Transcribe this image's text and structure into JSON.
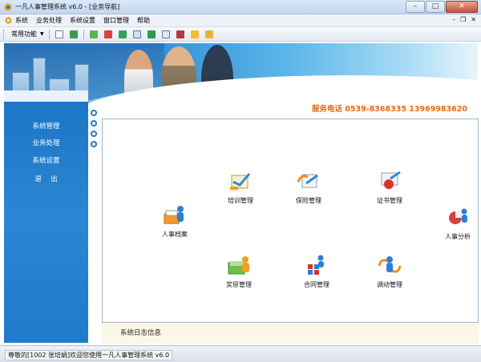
{
  "window": {
    "title": "一凡人事管理系统 v6.0 - [业务导航]",
    "minimize": "–",
    "maximize": "□",
    "close": "✕"
  },
  "menu": {
    "items": [
      "系统",
      "业务处理",
      "系统设置",
      "窗口管理",
      "帮助"
    ],
    "mdi_minimize": "–",
    "mdi_restore": "❐",
    "mdi_close": "✕"
  },
  "toolbar": {
    "dropdown_label": "常用功能"
  },
  "banner": {
    "hotline": "服务电话  0539-8368335  13969983620"
  },
  "nav": {
    "items": [
      "系统管理",
      "业务处理",
      "系统设置",
      "退　 出"
    ]
  },
  "modules": {
    "training": "培训管理",
    "insurance": "保险管理",
    "certificate": "证书管理",
    "personnel_file": "人事档案",
    "personnel_analysis": "人事分析",
    "reward_punish": "奖惩管理",
    "contract": "合同管理",
    "transfer": "调动管理"
  },
  "log": {
    "label": "系统日志信息"
  },
  "status": {
    "text": "尊敬的[1002 张培娟]欢迎您使用一凡人事管理系统 v6.0"
  },
  "colors": {
    "hotline": "#e76a10",
    "nav_panel": "#1f7bcb",
    "log_area": "#fbf7e6"
  }
}
